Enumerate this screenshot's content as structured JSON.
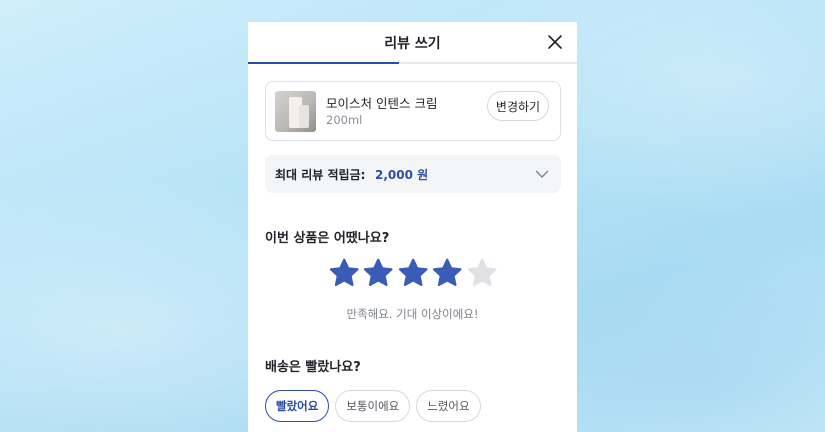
{
  "header": {
    "title": "리뷰 쓰기",
    "close_icon": "close-icon"
  },
  "product": {
    "name": "모이스처 인텐스 크림",
    "size": "200ml",
    "change_label": "변경하기"
  },
  "reward": {
    "label": "최대 리뷰 적립금:",
    "amount": "2,000 원",
    "chevron_icon": "chevron-down-icon"
  },
  "rating": {
    "question": "이번 상품은 어땠나요?",
    "value": 4,
    "max": 5,
    "description": "만족해요. 기대 이상이에요!"
  },
  "delivery": {
    "question": "배송은 빨랐나요?",
    "options": [
      "빨랐어요",
      "보통이에요",
      "느렸어요"
    ],
    "selected": "빨랐어요"
  },
  "colors": {
    "accent": "#2c4fa3",
    "star_active": "#3a5bb8",
    "star_inactive": "#dfe1e5"
  }
}
